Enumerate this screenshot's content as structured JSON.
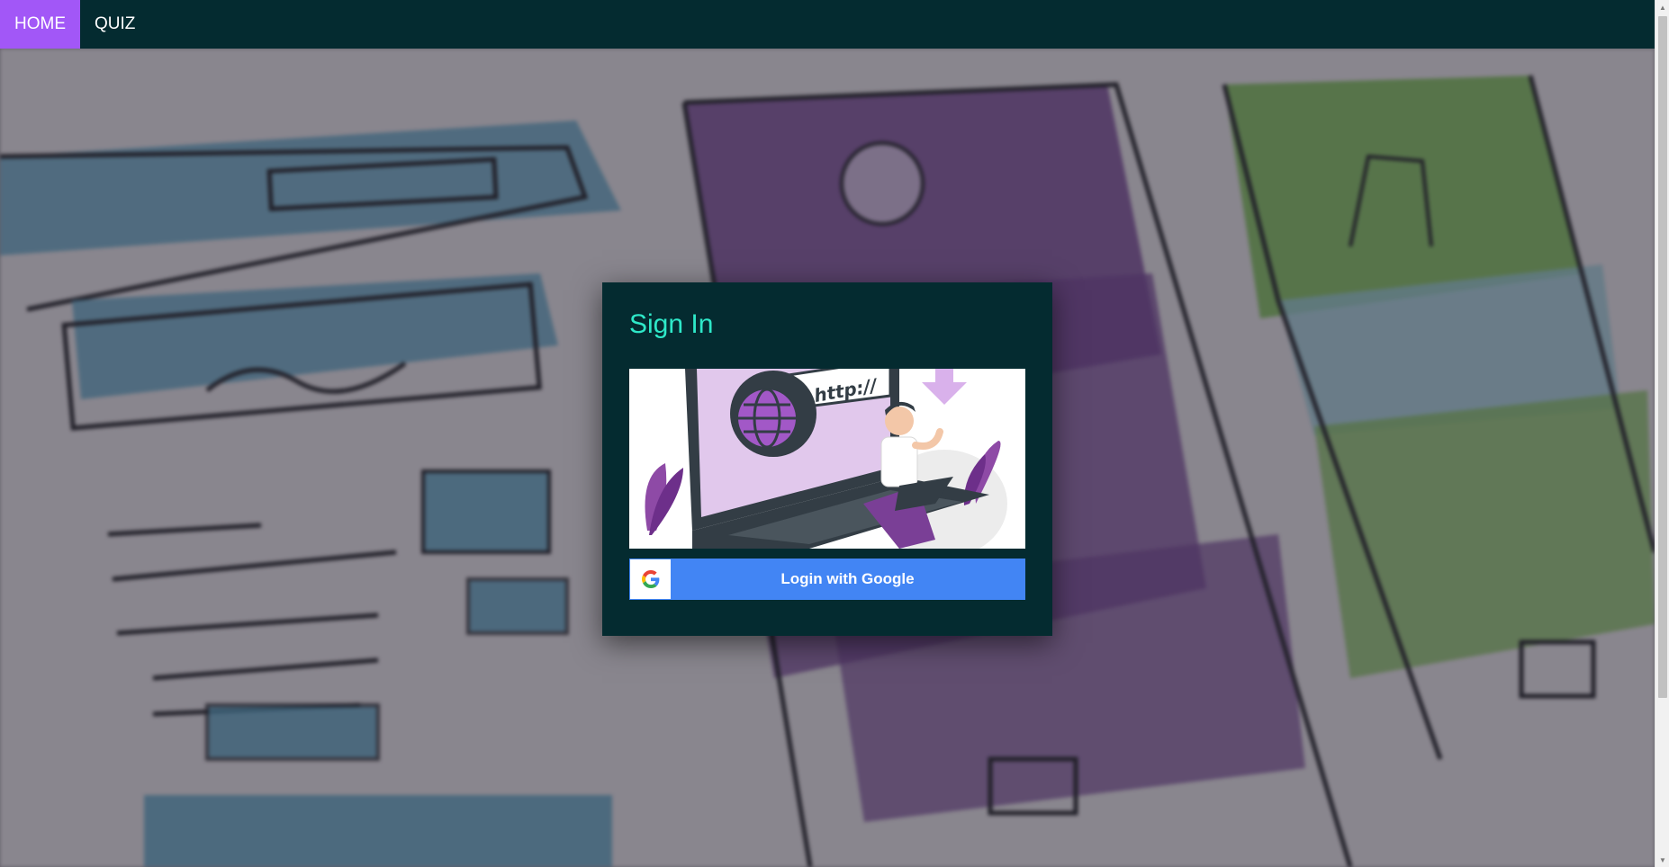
{
  "nav": {
    "items": [
      {
        "label": "HOME",
        "active": true
      },
      {
        "label": "QUIZ",
        "active": false
      }
    ]
  },
  "signin": {
    "title": "Sign In",
    "illustration_text": "http://",
    "google_button_label": "Login with Google",
    "google_icon": "google-g-icon"
  },
  "colors": {
    "navbar_bg": "#042b30",
    "nav_active_bg": "#a257f7",
    "card_bg": "#042b30",
    "title_color": "#2ee8c8",
    "google_blue": "#4285f4"
  }
}
